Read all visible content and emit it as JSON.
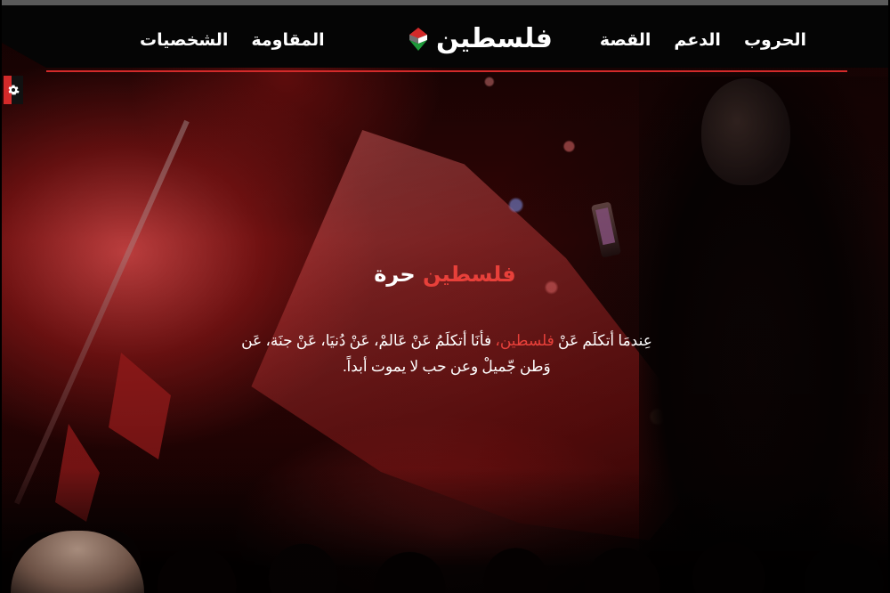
{
  "header": {
    "brand": "فلسطين",
    "nav_right": [
      "الحروب",
      "الدعم",
      "القصة"
    ],
    "nav_left": [
      "المقاومة",
      "الشخصيات"
    ]
  },
  "settings": {
    "icon": "gear-icon"
  },
  "hero": {
    "title_accent": "فلسطين",
    "title_rest": "حرة",
    "text_part1": "عِندمَا أتكلَم عَنْ ",
    "text_accent": "فلسطين،",
    "text_part2": " فأنَا أتكلَمُ عَنْ عَالمْ، عَنْ دُنيَا، عَنْ جنَة، عَن وَطن جّميلْ وعن حب لا يموت أبداً."
  },
  "colors": {
    "accent": "#e8403a",
    "header_bg": "#050505",
    "header_line": "#d32a2a"
  }
}
